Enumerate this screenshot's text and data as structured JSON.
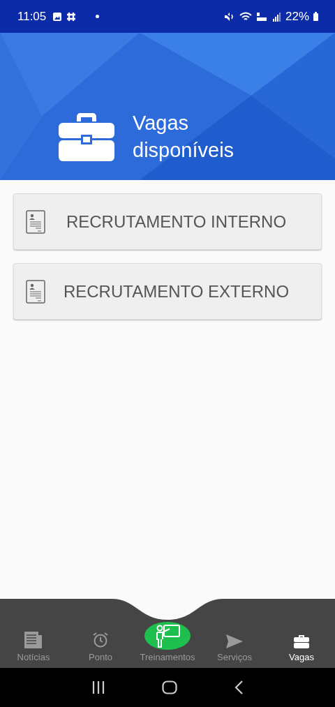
{
  "status_bar": {
    "time": "11:05",
    "battery": "22%"
  },
  "header": {
    "title": "Vagas disponíveis"
  },
  "options": [
    {
      "label": "RECRUTAMENTO INTERNO"
    },
    {
      "label": "RECRUTAMENTO EXTERNO"
    }
  ],
  "bottom_nav": [
    {
      "label": "Notícias",
      "kind": "news",
      "selected": false
    },
    {
      "label": "Ponto",
      "kind": "clock",
      "selected": false
    },
    {
      "label": "Treinamentos",
      "kind": "training",
      "selected": false
    },
    {
      "label": "Serviços",
      "kind": "send",
      "selected": false
    },
    {
      "label": "Vagas",
      "kind": "briefcase",
      "selected": true
    }
  ]
}
